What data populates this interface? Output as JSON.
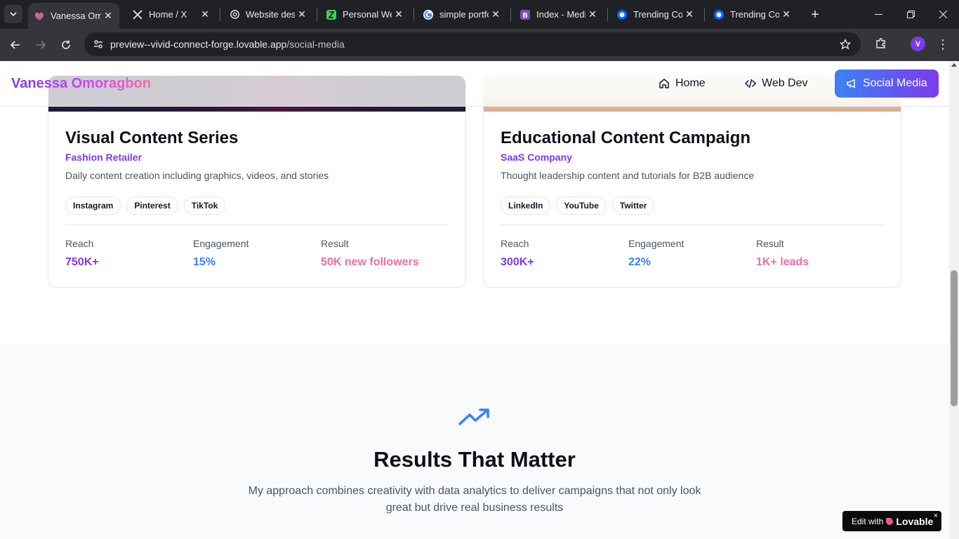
{
  "browser": {
    "tabs": [
      {
        "title": "Vanessa Om",
        "favicon": "lovable-heart-icon",
        "active": true
      },
      {
        "title": "Home / X",
        "favicon": "x-logo-icon",
        "active": false
      },
      {
        "title": "Website desi",
        "favicon": "openai-icon",
        "active": false
      },
      {
        "title": "Personal Wel",
        "favicon": "framer-icon",
        "active": false
      },
      {
        "title": "simple portfo",
        "favicon": "google-icon",
        "active": false
      },
      {
        "title": "Index - Medi",
        "favicon": "bootstrap-icon",
        "active": false
      },
      {
        "title": "Trending Col",
        "favicon": "coolors-icon",
        "active": false
      },
      {
        "title": "Trending Col",
        "favicon": "coolors-icon",
        "active": false
      }
    ],
    "url_host": "preview--vivid-connect-forge.lovable.app",
    "url_path": "/social-media",
    "profile_initial": "V"
  },
  "header": {
    "brand": "Vanessa Omoragbon",
    "nav": [
      {
        "label": "Home",
        "icon": "home-icon"
      },
      {
        "label": "Web Dev",
        "icon": "code-icon"
      },
      {
        "label": "Social Media",
        "icon": "megaphone-icon",
        "active": true
      }
    ]
  },
  "projects": [
    {
      "title": "Visual Content Series",
      "client": "Fashion Retailer",
      "description": "Daily content creation including graphics, videos, and stories",
      "tags": [
        "Instagram",
        "Pinterest",
        "TikTok"
      ],
      "stats": [
        {
          "label": "Reach",
          "value": "750K+"
        },
        {
          "label": "Engagement",
          "value": "15%"
        },
        {
          "label": "Result",
          "value": "50K new followers"
        }
      ]
    },
    {
      "title": "Educational Content Campaign",
      "client": "SaaS Company",
      "description": "Thought leadership content and tutorials for B2B audience",
      "tags": [
        "LinkedIn",
        "YouTube",
        "Twitter"
      ],
      "stats": [
        {
          "label": "Reach",
          "value": "300K+"
        },
        {
          "label": "Engagement",
          "value": "22%"
        },
        {
          "label": "Result",
          "value": "1K+ leads"
        }
      ]
    }
  ],
  "results": {
    "icon": "trending-up-icon",
    "title": "Results That Matter",
    "description": "My approach combines creativity with data analytics to deliver campaigns that not only look great but drive real business results"
  },
  "badge": {
    "prefix": "Edit with",
    "brand": "Lovable",
    "close": "×"
  },
  "colors": {
    "accent_purple": "#7c3aed",
    "accent_blue": "#3b82f6",
    "accent_pink": "#ec6fa4"
  }
}
